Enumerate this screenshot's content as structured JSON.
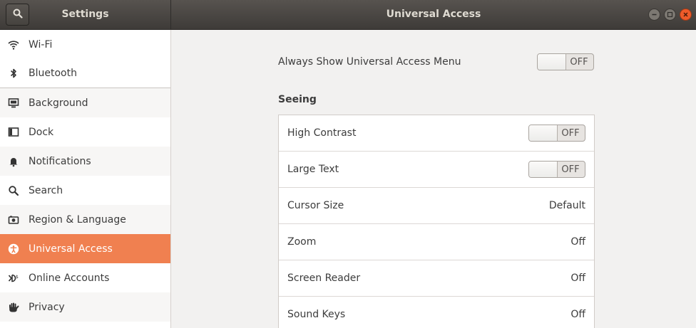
{
  "header": {
    "left_title": "Settings",
    "right_title": "Universal Access",
    "search_icon": "search-icon",
    "window_buttons": [
      "minimize-icon",
      "maximize-icon",
      "close-icon"
    ]
  },
  "sidebar": {
    "items": [
      {
        "label": "Wi-Fi",
        "icon": "wifi-icon"
      },
      {
        "label": "Bluetooth",
        "icon": "bluetooth-icon"
      },
      {
        "label": "Background",
        "icon": "background-icon"
      },
      {
        "label": "Dock",
        "icon": "dock-icon"
      },
      {
        "label": "Notifications",
        "icon": "bell-icon"
      },
      {
        "label": "Search",
        "icon": "search-icon"
      },
      {
        "label": "Region & Language",
        "icon": "camera-icon"
      },
      {
        "label": "Universal Access",
        "icon": "accessibility-icon",
        "active": true
      },
      {
        "label": "Online Accounts",
        "icon": "online-accounts-icon"
      },
      {
        "label": "Privacy",
        "icon": "hand-icon"
      }
    ]
  },
  "main": {
    "menu_label": "Always Show Universal Access Menu",
    "menu_switch": "OFF",
    "seeing_title": "Seeing",
    "rows": [
      {
        "label": "High Contrast",
        "switch": "OFF"
      },
      {
        "label": "Large Text",
        "switch": "OFF"
      },
      {
        "label": "Cursor Size",
        "value": "Default"
      },
      {
        "label": "Zoom",
        "value": "Off"
      },
      {
        "label": "Screen Reader",
        "value": "Off"
      },
      {
        "label": "Sound Keys",
        "value": "Off"
      }
    ]
  },
  "colors": {
    "accent": "#f08050",
    "header_bg": "#4a4744",
    "close_button": "#ee5b2a"
  }
}
